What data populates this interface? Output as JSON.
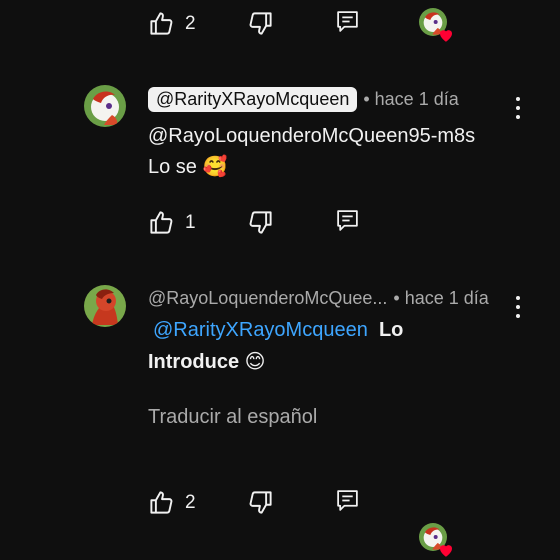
{
  "top_actions": {
    "like_count": "2"
  },
  "comment1": {
    "author": "@RarityXRayoMcqueen",
    "time": "• hace 1 día",
    "line1": "@RayoLoquenderoMcQueen95-m8s",
    "line2": "Lo se 🥰",
    "like_count": "1"
  },
  "comment2": {
    "author": "@RayoLoquenderoMcQuee...",
    "time": "• hace 1 día",
    "mention": "@RarityXRayoMcqueen",
    "text_after_mention": "Lo",
    "line2": "Introduce 😊",
    "translate": "Traducir al español",
    "like_count": "2"
  },
  "icons": {
    "like": "thumbs-up-icon",
    "dislike": "thumbs-down-icon",
    "reply": "reply-icon",
    "more": "more-vert-icon",
    "creator_heart": "creator-heart-icon"
  },
  "colors": {
    "background": "#0f0f0f",
    "text": "#f1f1f1",
    "secondary_text": "#aaaaaa",
    "mention": "#3ea6ff",
    "heart": "#ff0033"
  }
}
